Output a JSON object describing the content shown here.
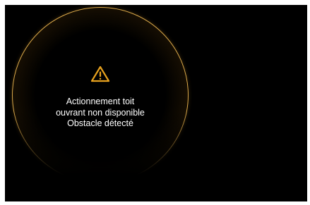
{
  "alert": {
    "icon": "warning-triangle-icon",
    "accent_color": "#e8a21e",
    "lines": [
      "Actionnement toit",
      "ouvrant non disponible",
      "Obstacle détecté"
    ]
  }
}
